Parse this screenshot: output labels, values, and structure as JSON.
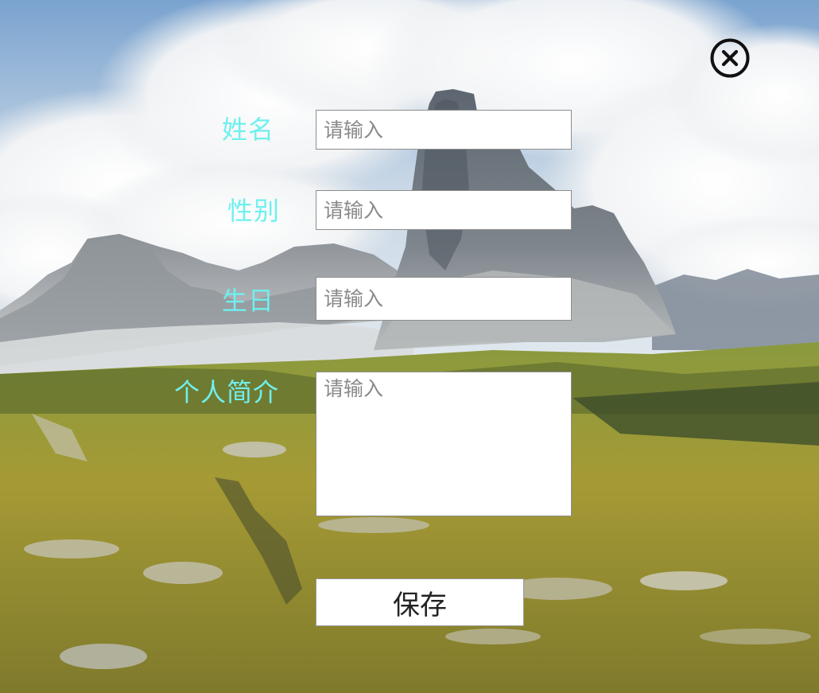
{
  "form": {
    "fields": [
      {
        "label": "姓名",
        "placeholder": "请输入",
        "value": ""
      },
      {
        "label": "性别",
        "placeholder": "请输入",
        "value": ""
      },
      {
        "label": "生日",
        "placeholder": "请输入",
        "value": ""
      },
      {
        "label": "个人简介",
        "placeholder": "请输入",
        "value": ""
      }
    ],
    "save_label": "保存"
  },
  "icons": {
    "close": "close-circle-icon"
  },
  "colors": {
    "label": "#6ff0ee",
    "field_bg": "#ffffff",
    "field_border": "#8d8d8d",
    "close_icon": "#111111"
  }
}
